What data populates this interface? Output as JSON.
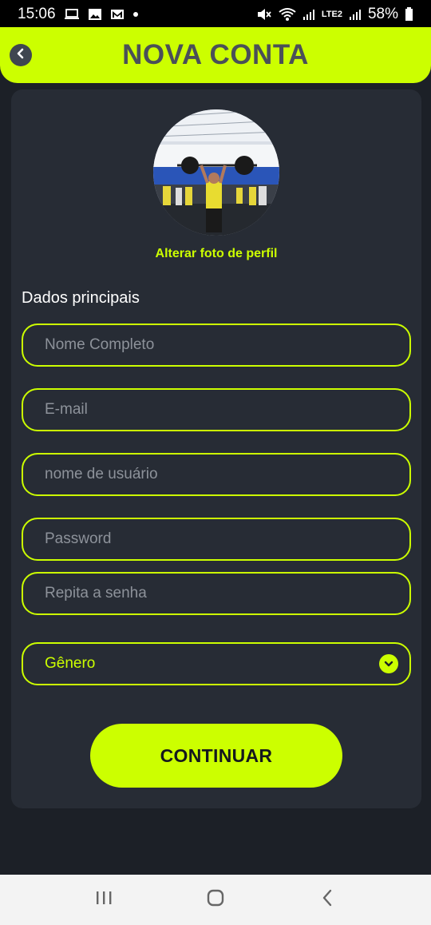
{
  "status_bar": {
    "time": "15:06",
    "battery": "58%",
    "network_label": "LTE2"
  },
  "header": {
    "title": "NOVA CONTA"
  },
  "profile": {
    "change_photo_label": "Alterar foto de perfil"
  },
  "form": {
    "section_title": "Dados principais",
    "full_name_placeholder": "Nome Completo",
    "email_placeholder": "E-mail",
    "username_placeholder": "nome de usuário",
    "password_placeholder": "Password",
    "repeat_password_placeholder": "Repita a senha",
    "gender_label": "Gênero",
    "continue_label": "CONTINUAR"
  },
  "colors": {
    "accent": "#ccff00",
    "background": "#1c2027",
    "card": "#272c35"
  },
  "icons": [
    "back-icon",
    "chevron-down-icon",
    "recent-apps-icon",
    "home-icon",
    "nav-back-icon"
  ]
}
